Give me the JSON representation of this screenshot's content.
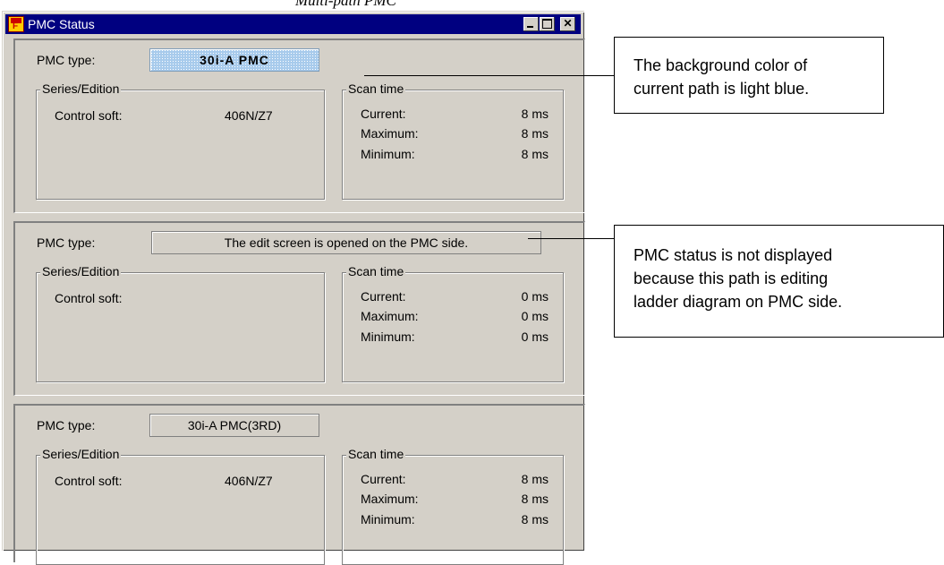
{
  "page_caption": "Multi-path PMC",
  "window": {
    "title": "PMC Status",
    "buttons": {
      "minimize": "_",
      "maximize": "□",
      "close": "✕"
    }
  },
  "labels": {
    "pmc_type": "PMC type:",
    "series_edition": "Series/Edition",
    "control_soft": "Control soft:",
    "scan_time": "Scan time",
    "current": "Current:",
    "maximum": "Maximum:",
    "minimum": "Minimum:"
  },
  "paths": [
    {
      "pmc_type": "30i-A PMC",
      "highlighted": true,
      "highlight_color": "#a8cbec",
      "control_soft": "406N/Z7",
      "scan": {
        "current": "8 ms",
        "maximum": "8 ms",
        "minimum": "8 ms"
      }
    },
    {
      "pmc_type": "The edit screen is opened on the PMC side.",
      "highlighted": false,
      "control_soft": "",
      "scan": {
        "current": "0 ms",
        "maximum": "0 ms",
        "minimum": "0 ms"
      }
    },
    {
      "pmc_type": "30i-A PMC(3RD)",
      "highlighted": false,
      "control_soft": "406N/Z7",
      "scan": {
        "current": "8 ms",
        "maximum": "8 ms",
        "minimum": "8 ms"
      }
    }
  ],
  "callouts": [
    {
      "lines": [
        "The background color of",
        "current path is light blue."
      ]
    },
    {
      "lines": [
        "PMC status is not displayed",
        "because this path is editing",
        "ladder diagram on PMC side."
      ]
    }
  ],
  "colors": {
    "titlebar": "#000080",
    "window_face": "#d4d0c8",
    "current_path": "#a8cbec"
  }
}
